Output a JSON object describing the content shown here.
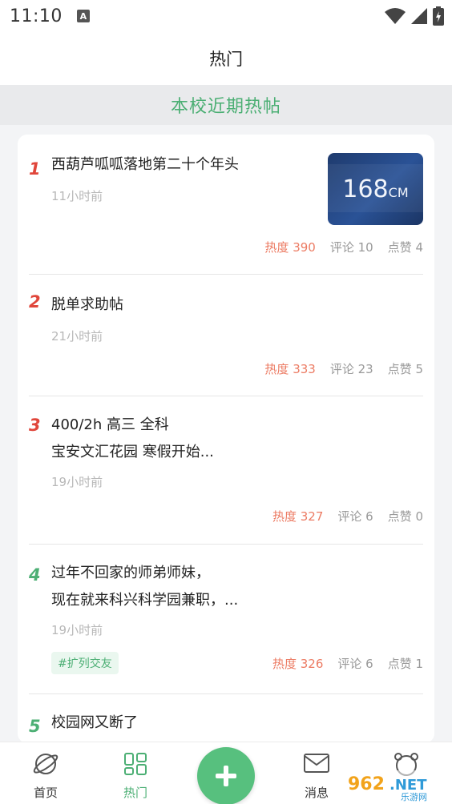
{
  "status": {
    "time": "11:10",
    "a_badge": "A"
  },
  "header": {
    "title": "热门"
  },
  "banner": {
    "title": "本校近期热帖"
  },
  "posts": [
    {
      "rank": "1",
      "title": "西葫芦呱呱落地第二十个年头",
      "time": "11小时前",
      "heat": "热度 390",
      "comments": "评论 10",
      "likes": "点赞 4",
      "thumb_text": "168",
      "thumb_unit": "CM"
    },
    {
      "rank": "2",
      "title": "脱单求助帖",
      "time": "21小时前",
      "heat": "热度 333",
      "comments": "评论 23",
      "likes": "点赞 5"
    },
    {
      "rank": "3",
      "title_line1": "400/2h 高三 全科",
      "title_line2": "宝安文汇花园 寒假开始...",
      "time": "19小时前",
      "heat": "热度 327",
      "comments": "评论 6",
      "likes": "点赞 0"
    },
    {
      "rank": "4",
      "title_line1": "过年不回家的师弟师妹，",
      "title_line2": "现在就来科兴科学园兼职，...",
      "time": "19小时前",
      "tag": "#扩列交友",
      "heat": "热度 326",
      "comments": "评论 6",
      "likes": "点赞 1"
    },
    {
      "rank": "5",
      "title": "校园网又断了"
    }
  ],
  "nav": {
    "home": "首页",
    "hot": "热门",
    "messages": "消息"
  },
  "watermark": {
    "text": "962.NET",
    "sub": "乐游网"
  },
  "colors": {
    "accent": "#4caf74",
    "rank_red": "#e0463b",
    "heat": "#ec7b63"
  }
}
